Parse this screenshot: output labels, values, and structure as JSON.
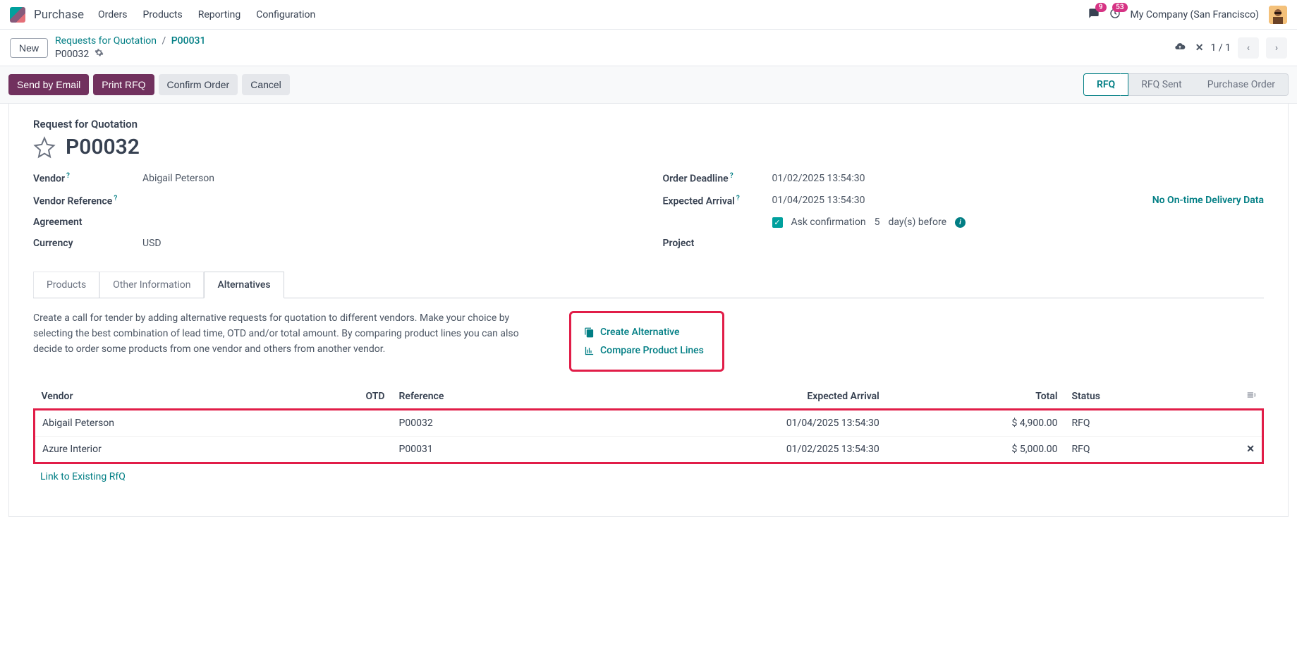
{
  "nav": {
    "app": "Purchase",
    "items": [
      "Orders",
      "Products",
      "Reporting",
      "Configuration"
    ],
    "msg_badge": "9",
    "clock_badge": "53",
    "company": "My Company (San Francisco)"
  },
  "breadcrumb": {
    "new_btn": "New",
    "root": "Requests for Quotation",
    "mid": "P00031",
    "current": "P00032",
    "pager": "1 / 1"
  },
  "actions": {
    "send": "Send by Email",
    "print": "Print RFQ",
    "confirm": "Confirm Order",
    "cancel": "Cancel"
  },
  "status": {
    "s1": "RFQ",
    "s2": "RFQ Sent",
    "s3": "Purchase Order"
  },
  "doc": {
    "section": "Request for Quotation",
    "name": "P00032",
    "fields": {
      "vendor_label": "Vendor",
      "vendor": "Abigail Peterson",
      "vendor_ref_label": "Vendor Reference",
      "vendor_ref": "",
      "agreement_label": "Agreement",
      "currency_label": "Currency",
      "currency": "USD",
      "deadline_label": "Order Deadline",
      "deadline": "01/02/2025 13:54:30",
      "arrival_label": "Expected Arrival",
      "arrival": "01/04/2025 13:54:30",
      "delivery_badge": "No On-time Delivery Data",
      "ask_conf": "Ask confirmation",
      "ask_days": "5",
      "ask_suffix": "day(s) before",
      "project_label": "Project"
    }
  },
  "tabs": {
    "products": "Products",
    "other": "Other Information",
    "alt": "Alternatives"
  },
  "tender": {
    "text": "Create a call for tender by adding alternative requests for quotation to different vendors. Make your choice by selecting the best combination of lead time, OTD and/or total amount. By comparing product lines you can also decide to order some products from one vendor and others from another vendor.",
    "create": "Create Alternative",
    "compare": "Compare Product Lines"
  },
  "table": {
    "headers": {
      "vendor": "Vendor",
      "otd": "OTD",
      "ref": "Reference",
      "arrival": "Expected Arrival",
      "total": "Total",
      "status": "Status"
    },
    "rows": [
      {
        "vendor": "Abigail Peterson",
        "otd": "",
        "ref": "P00032",
        "arrival": "01/04/2025 13:54:30",
        "total": "$ 4,900.00",
        "status": "RFQ",
        "closable": false
      },
      {
        "vendor": "Azure Interior",
        "otd": "",
        "ref": "P00031",
        "arrival": "01/02/2025 13:54:30",
        "total": "$ 5,000.00",
        "status": "RFQ",
        "closable": true
      }
    ],
    "link": "Link to Existing RfQ"
  }
}
